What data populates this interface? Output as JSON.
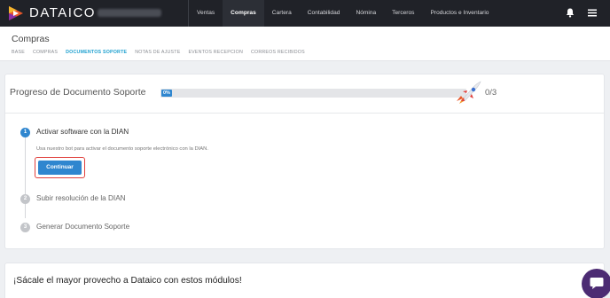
{
  "app": {
    "brand": "DATAICO",
    "company_name": ""
  },
  "nav": {
    "items": [
      {
        "label": "Ventas",
        "active": false
      },
      {
        "label": "Compras",
        "active": true
      },
      {
        "label": "Cartera",
        "active": false
      },
      {
        "label": "Contabilidad",
        "active": false
      },
      {
        "label": "Nómina",
        "active": false
      },
      {
        "label": "Terceros",
        "active": false
      },
      {
        "label": "Productos e Inventario",
        "active": false
      }
    ],
    "icons": [
      "bell-icon",
      "hamburger-menu-icon"
    ]
  },
  "header": {
    "title": "Compras",
    "tabs": [
      {
        "label": "BASE",
        "active": false
      },
      {
        "label": "COMPRAS",
        "active": false
      },
      {
        "label": "DOCUMENTOS SOPORTE",
        "active": true
      },
      {
        "label": "NOTAS DE AJUSTE",
        "active": false
      },
      {
        "label": "EVENTOS RECEPCION",
        "active": false
      },
      {
        "label": "CORREOS RECIBIDOS",
        "active": false
      }
    ]
  },
  "progress": {
    "title": "Progreso de Documento Soporte",
    "percent_label": "0%",
    "percent": 0,
    "count": "0/3",
    "icon": "rocket-icon"
  },
  "steps": [
    {
      "number": "1",
      "title": "Activar software con la DIAN",
      "active": true,
      "description": "Usa nuestro bot para activar el documento soporte electrónico con la DIAN.",
      "button_label": "Continuar"
    },
    {
      "number": "2",
      "title": "Subir resolución de la DIAN",
      "active": false
    },
    {
      "number": "3",
      "title": "Generar Documento Soporte",
      "active": false
    }
  ],
  "modules": {
    "title": "¡Sácale el mayor provecho a Dataico con estos módulos!"
  },
  "colors": {
    "accent": "#2f86cf",
    "active_tab": "#1ea0cf",
    "topbar": "#202228",
    "highlight_border": "#e0403d",
    "chat": "#4c2b73"
  }
}
